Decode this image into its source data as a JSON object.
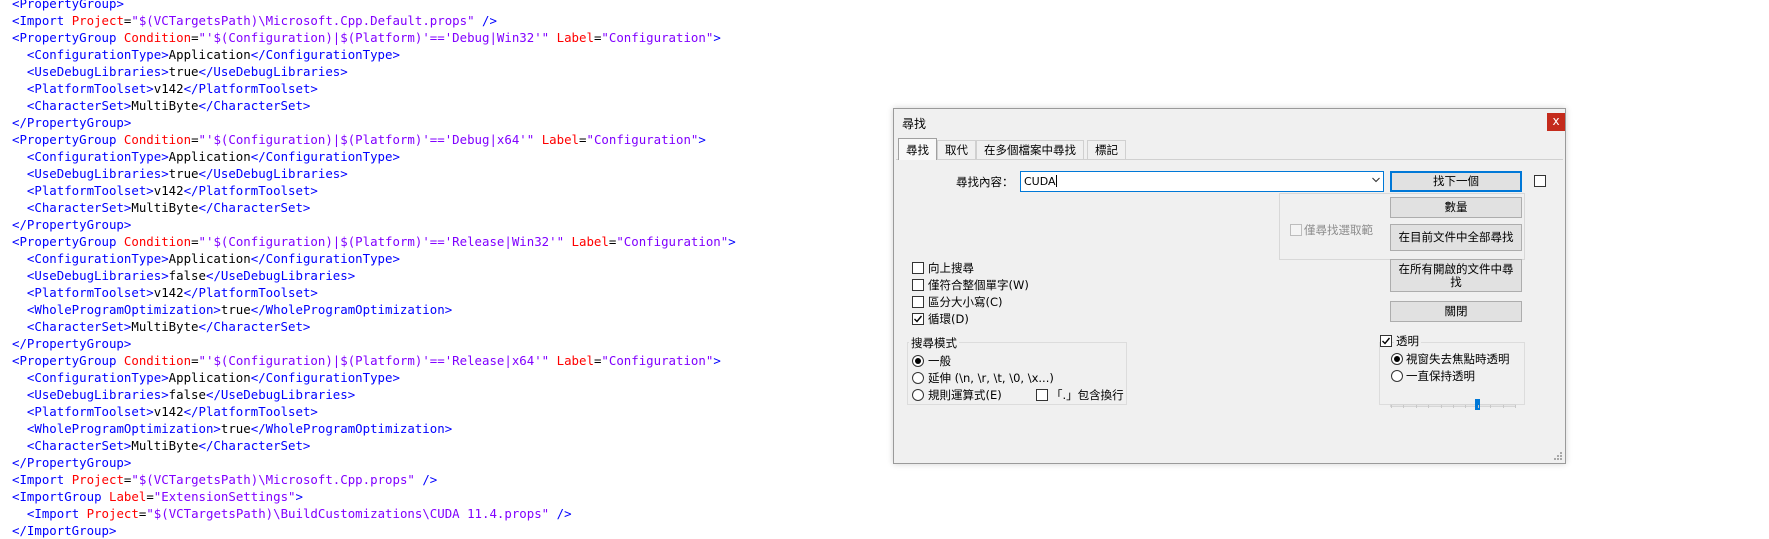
{
  "editor": {
    "lines": [
      [
        [
          "tag",
          "<"
        ],
        [
          "tag",
          "PropertyGroup"
        ],
        [
          "tag",
          ">"
        ]
      ],
      [
        [
          "tag",
          "<"
        ],
        [
          "tag",
          "Import"
        ],
        [
          "text",
          " "
        ],
        [
          "attr",
          "Project"
        ],
        [
          "text",
          "="
        ],
        [
          "val",
          "\"$(VCTargetsPath)\\Microsoft.Cpp.Default.props\""
        ],
        [
          "text",
          " "
        ],
        [
          "tag",
          "/>"
        ]
      ],
      [
        [
          "tag",
          "<"
        ],
        [
          "tag",
          "PropertyGroup"
        ],
        [
          "text",
          " "
        ],
        [
          "attr",
          "Condition"
        ],
        [
          "text",
          "="
        ],
        [
          "val",
          "\"'$(Configuration)|$(Platform)'=='Debug|Win32'\""
        ],
        [
          "text",
          " "
        ],
        [
          "attr",
          "Label"
        ],
        [
          "text",
          "="
        ],
        [
          "val",
          "\"Configuration\""
        ],
        [
          "tag",
          ">"
        ]
      ],
      [
        [
          "text",
          "  "
        ],
        [
          "tag",
          "<ConfigurationType>"
        ],
        [
          "text",
          "Application"
        ],
        [
          "tag",
          "</ConfigurationType>"
        ]
      ],
      [
        [
          "text",
          "  "
        ],
        [
          "tag",
          "<UseDebugLibraries>"
        ],
        [
          "text",
          "true"
        ],
        [
          "tag",
          "</UseDebugLibraries>"
        ]
      ],
      [
        [
          "text",
          "  "
        ],
        [
          "tag",
          "<PlatformToolset>"
        ],
        [
          "text",
          "v142"
        ],
        [
          "tag",
          "</PlatformToolset>"
        ]
      ],
      [
        [
          "text",
          "  "
        ],
        [
          "tag",
          "<CharacterSet>"
        ],
        [
          "text",
          "MultiByte"
        ],
        [
          "tag",
          "</CharacterSet>"
        ]
      ],
      [
        [
          "tag",
          "</PropertyGroup>"
        ]
      ],
      [
        [
          "tag",
          "<"
        ],
        [
          "tag",
          "PropertyGroup"
        ],
        [
          "text",
          " "
        ],
        [
          "attr",
          "Condition"
        ],
        [
          "text",
          "="
        ],
        [
          "val",
          "\"'$(Configuration)|$(Platform)'=='Debug|x64'\""
        ],
        [
          "text",
          " "
        ],
        [
          "attr",
          "Label"
        ],
        [
          "text",
          "="
        ],
        [
          "val",
          "\"Configuration\""
        ],
        [
          "tag",
          ">"
        ]
      ],
      [
        [
          "text",
          "  "
        ],
        [
          "tag",
          "<ConfigurationType>"
        ],
        [
          "text",
          "Application"
        ],
        [
          "tag",
          "</ConfigurationType>"
        ]
      ],
      [
        [
          "text",
          "  "
        ],
        [
          "tag",
          "<UseDebugLibraries>"
        ],
        [
          "text",
          "true"
        ],
        [
          "tag",
          "</UseDebugLibraries>"
        ]
      ],
      [
        [
          "text",
          "  "
        ],
        [
          "tag",
          "<PlatformToolset>"
        ],
        [
          "text",
          "v142"
        ],
        [
          "tag",
          "</PlatformToolset>"
        ]
      ],
      [
        [
          "text",
          "  "
        ],
        [
          "tag",
          "<CharacterSet>"
        ],
        [
          "text",
          "MultiByte"
        ],
        [
          "tag",
          "</CharacterSet>"
        ]
      ],
      [
        [
          "tag",
          "</PropertyGroup>"
        ]
      ],
      [
        [
          "tag",
          "<"
        ],
        [
          "tag",
          "PropertyGroup"
        ],
        [
          "text",
          " "
        ],
        [
          "attr",
          "Condition"
        ],
        [
          "text",
          "="
        ],
        [
          "val",
          "\"'$(Configuration)|$(Platform)'=='Release|Win32'\""
        ],
        [
          "text",
          " "
        ],
        [
          "attr",
          "Label"
        ],
        [
          "text",
          "="
        ],
        [
          "val",
          "\"Configuration\""
        ],
        [
          "tag",
          ">"
        ]
      ],
      [
        [
          "text",
          "  "
        ],
        [
          "tag",
          "<ConfigurationType>"
        ],
        [
          "text",
          "Application"
        ],
        [
          "tag",
          "</ConfigurationType>"
        ]
      ],
      [
        [
          "text",
          "  "
        ],
        [
          "tag",
          "<UseDebugLibraries>"
        ],
        [
          "text",
          "false"
        ],
        [
          "tag",
          "</UseDebugLibraries>"
        ]
      ],
      [
        [
          "text",
          "  "
        ],
        [
          "tag",
          "<PlatformToolset>"
        ],
        [
          "text",
          "v142"
        ],
        [
          "tag",
          "</PlatformToolset>"
        ]
      ],
      [
        [
          "text",
          "  "
        ],
        [
          "tag",
          "<WholeProgramOptimization>"
        ],
        [
          "text",
          "true"
        ],
        [
          "tag",
          "</WholeProgramOptimization>"
        ]
      ],
      [
        [
          "text",
          "  "
        ],
        [
          "tag",
          "<CharacterSet>"
        ],
        [
          "text",
          "MultiByte"
        ],
        [
          "tag",
          "</CharacterSet>"
        ]
      ],
      [
        [
          "tag",
          "</PropertyGroup>"
        ]
      ],
      [
        [
          "tag",
          "<"
        ],
        [
          "tag",
          "PropertyGroup"
        ],
        [
          "text",
          " "
        ],
        [
          "attr",
          "Condition"
        ],
        [
          "text",
          "="
        ],
        [
          "val",
          "\"'$(Configuration)|$(Platform)'=='Release|x64'\""
        ],
        [
          "text",
          " "
        ],
        [
          "attr",
          "Label"
        ],
        [
          "text",
          "="
        ],
        [
          "val",
          "\"Configuration\""
        ],
        [
          "tag",
          ">"
        ]
      ],
      [
        [
          "text",
          "  "
        ],
        [
          "tag",
          "<ConfigurationType>"
        ],
        [
          "text",
          "Application"
        ],
        [
          "tag",
          "</ConfigurationType>"
        ]
      ],
      [
        [
          "text",
          "  "
        ],
        [
          "tag",
          "<UseDebugLibraries>"
        ],
        [
          "text",
          "false"
        ],
        [
          "tag",
          "</UseDebugLibraries>"
        ]
      ],
      [
        [
          "text",
          "  "
        ],
        [
          "tag",
          "<PlatformToolset>"
        ],
        [
          "text",
          "v142"
        ],
        [
          "tag",
          "</PlatformToolset>"
        ]
      ],
      [
        [
          "text",
          "  "
        ],
        [
          "tag",
          "<WholeProgramOptimization>"
        ],
        [
          "text",
          "true"
        ],
        [
          "tag",
          "</WholeProgramOptimization>"
        ]
      ],
      [
        [
          "text",
          "  "
        ],
        [
          "tag",
          "<CharacterSet>"
        ],
        [
          "text",
          "MultiByte"
        ],
        [
          "tag",
          "</CharacterSet>"
        ]
      ],
      [
        [
          "tag",
          "</PropertyGroup>"
        ]
      ],
      [
        [
          "tag",
          "<"
        ],
        [
          "tag",
          "Import"
        ],
        [
          "text",
          " "
        ],
        [
          "attr",
          "Project"
        ],
        [
          "text",
          "="
        ],
        [
          "val",
          "\"$(VCTargetsPath)\\Microsoft.Cpp.props\""
        ],
        [
          "text",
          " "
        ],
        [
          "tag",
          "/>"
        ]
      ],
      [
        [
          "tag",
          "<"
        ],
        [
          "tag",
          "ImportGroup"
        ],
        [
          "text",
          " "
        ],
        [
          "attr",
          "Label"
        ],
        [
          "text",
          "="
        ],
        [
          "val",
          "\"ExtensionSettings\""
        ],
        [
          "tag",
          ">"
        ]
      ],
      [
        [
          "text",
          "  "
        ],
        [
          "tag",
          "<"
        ],
        [
          "tag",
          "Import"
        ],
        [
          "text",
          " "
        ],
        [
          "attr",
          "Project"
        ],
        [
          "text",
          "="
        ],
        [
          "val",
          "\"$(VCTargetsPath)\\BuildCustomizations\\CUDA 11.4.props\""
        ],
        [
          "text",
          " "
        ],
        [
          "tag",
          "/>"
        ]
      ],
      [
        [
          "tag",
          "</ImportGroup>"
        ]
      ]
    ]
  },
  "dialog": {
    "title": "尋找",
    "close_glyph": "x",
    "tabs": [
      "尋找",
      "取代",
      "在多個檔案中尋找",
      "標記"
    ],
    "find_label": "尋找內容：",
    "find_value": "CUDA",
    "buttons": {
      "find_next": "找下一個",
      "count": "數量",
      "find_all_current": "在目前文件中全部尋找",
      "find_all_open": "在所有開啟的文件中尋找",
      "close": "關閉"
    },
    "in_selection": "僅尋找選取範",
    "options": {
      "backward": "向上搜尋",
      "whole_word": "僅符合整個單字(W)",
      "match_case": "區分大小寫(C)",
      "wrap": "循環(D)"
    },
    "search_mode": {
      "title": "搜尋模式",
      "normal": "一般",
      "extended": "延伸 (\\n, \\r, \\t, \\0, \\x...)",
      "regex": "規則運算式(E)",
      "dot_newline": "「.」包含換行"
    },
    "transparency": {
      "title": "透明",
      "on_losing_focus": "視窗失去焦點時透明",
      "always": "一直保持透明",
      "slider_value": 0.7
    },
    "colors": {
      "accent": "#0078d7",
      "close_red": "#c42b1c"
    }
  }
}
